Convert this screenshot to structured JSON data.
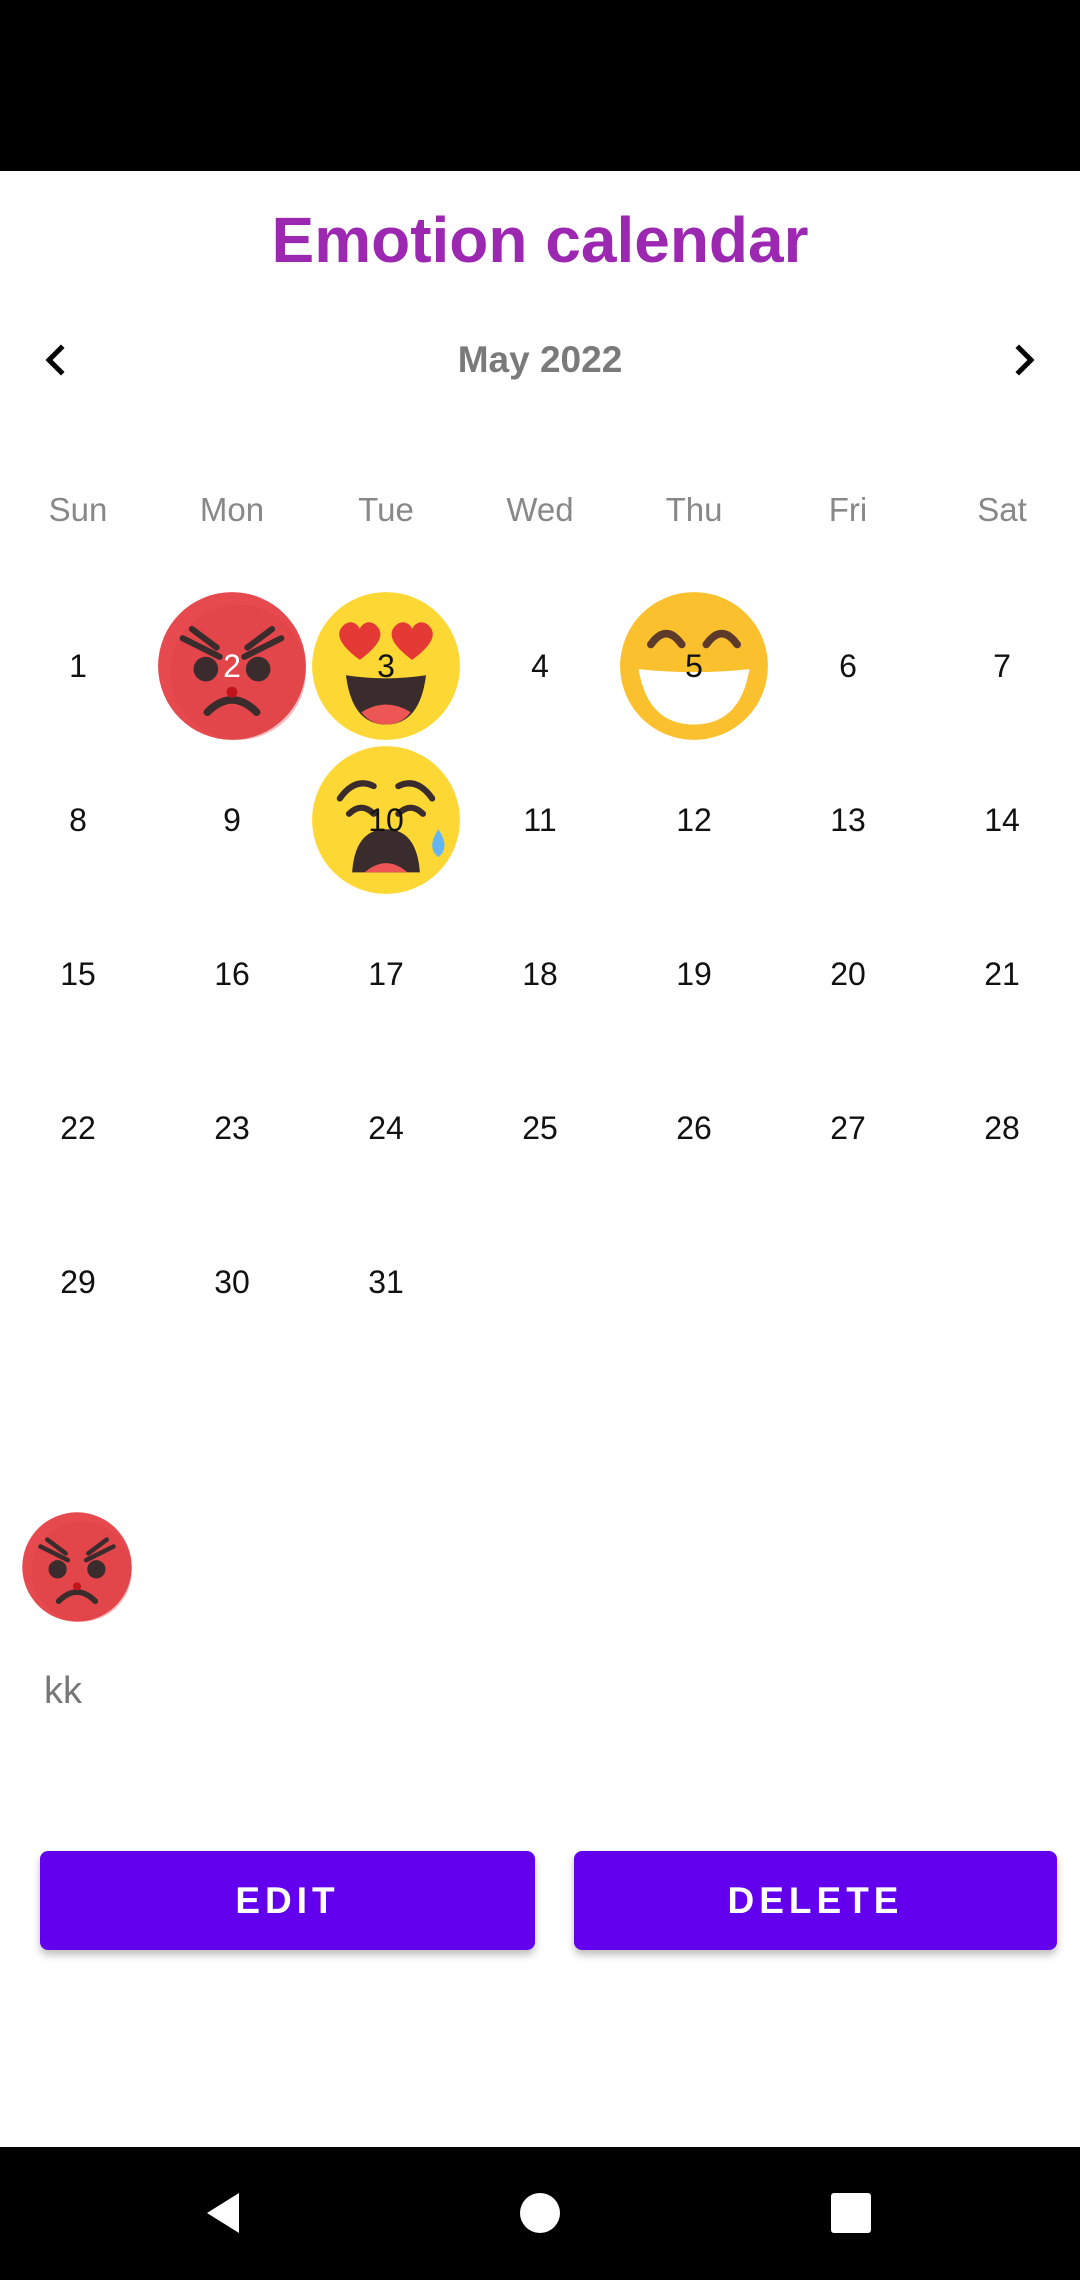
{
  "colors": {
    "title": "#9c27b0",
    "button": "#6200ee",
    "angry": "#e64a4f",
    "yellow": "#fdd835"
  },
  "app": {
    "title": "Emotion calendar"
  },
  "header": {
    "month_label": "May 2022",
    "prev_icon": "chevron-left-icon",
    "next_icon": "chevron-right-icon"
  },
  "weekdays": [
    "Sun",
    "Mon",
    "Tue",
    "Wed",
    "Thu",
    "Fri",
    "Sat"
  ],
  "calendar": {
    "days": [
      "1",
      "2",
      "3",
      "4",
      "5",
      "6",
      "7",
      "8",
      "9",
      "10",
      "11",
      "12",
      "13",
      "14",
      "15",
      "16",
      "17",
      "18",
      "19",
      "20",
      "21",
      "22",
      "23",
      "24",
      "25",
      "26",
      "27",
      "28",
      "29",
      "30",
      "31"
    ],
    "emotions": [
      {
        "day": "2",
        "icon": "angry-face-icon"
      },
      {
        "day": "3",
        "icon": "heart-eyes-face-icon"
      },
      {
        "day": "5",
        "icon": "grinning-face-icon"
      },
      {
        "day": "10",
        "icon": "crying-face-icon"
      }
    ]
  },
  "selected": {
    "icon": "angry-face-icon",
    "note": "kk"
  },
  "buttons": {
    "edit": "EDIT",
    "delete": "DELETE"
  },
  "system_nav": {
    "back": "back-icon",
    "home": "home-icon",
    "recents": "recents-icon"
  }
}
